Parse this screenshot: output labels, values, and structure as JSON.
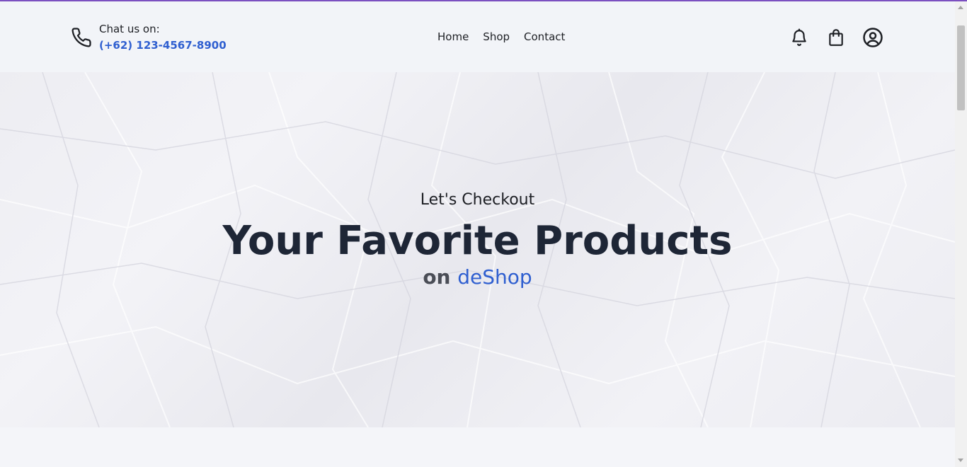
{
  "header": {
    "chat_label": "Chat us on:",
    "phone": "(+62) 123-4567-8900",
    "icons": {
      "phone": "phone-icon",
      "notifications": "bell-icon",
      "cart": "shopping-bag-icon",
      "account": "user-circle-icon"
    }
  },
  "nav": {
    "items": [
      "Home",
      "Shop",
      "Contact"
    ]
  },
  "hero": {
    "subtitle": "Let's Checkout",
    "title": "Your Favorite Products",
    "tag_prefix": "on",
    "brand": "deShop"
  },
  "colors": {
    "accent": "#2f5fd0",
    "top_line": "#7b4fc0",
    "title": "#1e2636"
  }
}
